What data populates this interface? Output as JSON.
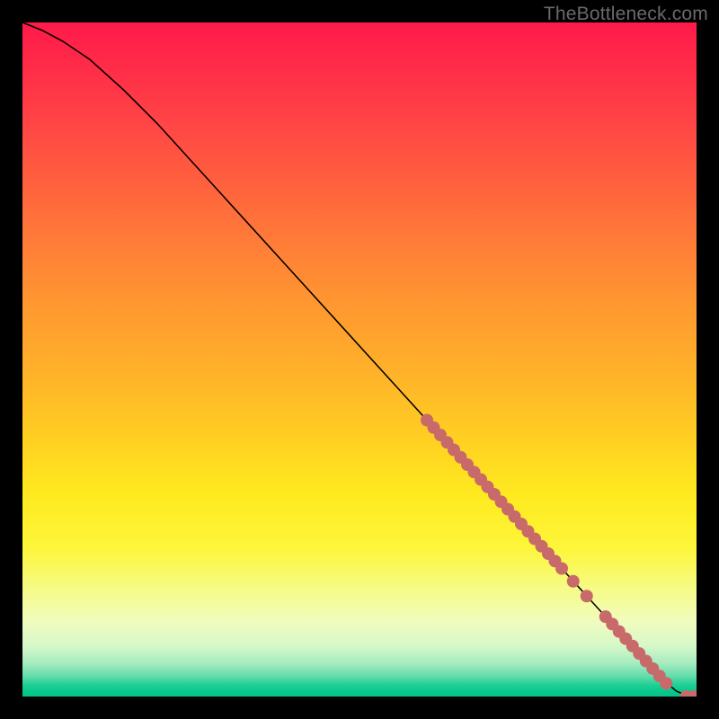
{
  "watermark": "TheBottleneck.com",
  "chart_data": {
    "type": "line",
    "title": "",
    "xlabel": "",
    "ylabel": "",
    "xlim": [
      0,
      100
    ],
    "ylim": [
      0,
      100
    ],
    "grid": false,
    "legend": false,
    "series": [
      {
        "name": "curve",
        "style": "line",
        "x": [
          0,
          3,
          6,
          10,
          15,
          20,
          30,
          40,
          50,
          60,
          64,
          70,
          76,
          80,
          84,
          88,
          90.5,
          93,
          95,
          97,
          98.5,
          100
        ],
        "y": [
          100,
          98.8,
          97.2,
          94.5,
          90.0,
          85.0,
          74.0,
          63.0,
          52.0,
          41.0,
          36.6,
          30.0,
          23.4,
          19.0,
          14.6,
          10.2,
          7.5,
          4.7,
          2.5,
          0.8,
          0.15,
          0.15
        ]
      },
      {
        "name": "highlight-cluster-upper",
        "style": "scatter",
        "x": [
          60.0,
          61.0,
          62.0,
          63.0,
          64.0,
          65.0,
          66.0,
          67.0,
          68.0,
          69.0,
          70.0,
          71.0,
          72.0,
          73.0,
          74.0,
          75.0,
          76.0,
          77.0,
          78.0,
          79.0,
          80.0,
          81.7,
          83.7
        ],
        "y": [
          41.0,
          39.9,
          38.8,
          37.7,
          36.6,
          35.5,
          34.4,
          33.3,
          32.2,
          31.1,
          30.0,
          28.9,
          27.8,
          26.7,
          25.6,
          24.5,
          23.4,
          22.3,
          21.2,
          20.1,
          19.0,
          17.1,
          14.9
        ]
      },
      {
        "name": "highlight-cluster-lower",
        "style": "scatter",
        "x": [
          86.5,
          87.5,
          88.5,
          89.5,
          90.5,
          91.5,
          92.5,
          93.5,
          94.5,
          95.5
        ],
        "y": [
          11.85,
          10.75,
          9.65,
          8.58,
          7.5,
          6.38,
          5.26,
          4.15,
          3.05,
          1.95
        ]
      },
      {
        "name": "highlight-end",
        "style": "scatter",
        "x": [
          98.4,
          99.6,
          100.0
        ],
        "y": [
          0.15,
          0.15,
          0.15
        ]
      }
    ],
    "colors": {
      "line": "#000000",
      "scatter": "#c86a6a",
      "background_gradient": [
        "#ff1a4a",
        "#ff7a38",
        "#ffea1f",
        "#05c388"
      ]
    }
  }
}
